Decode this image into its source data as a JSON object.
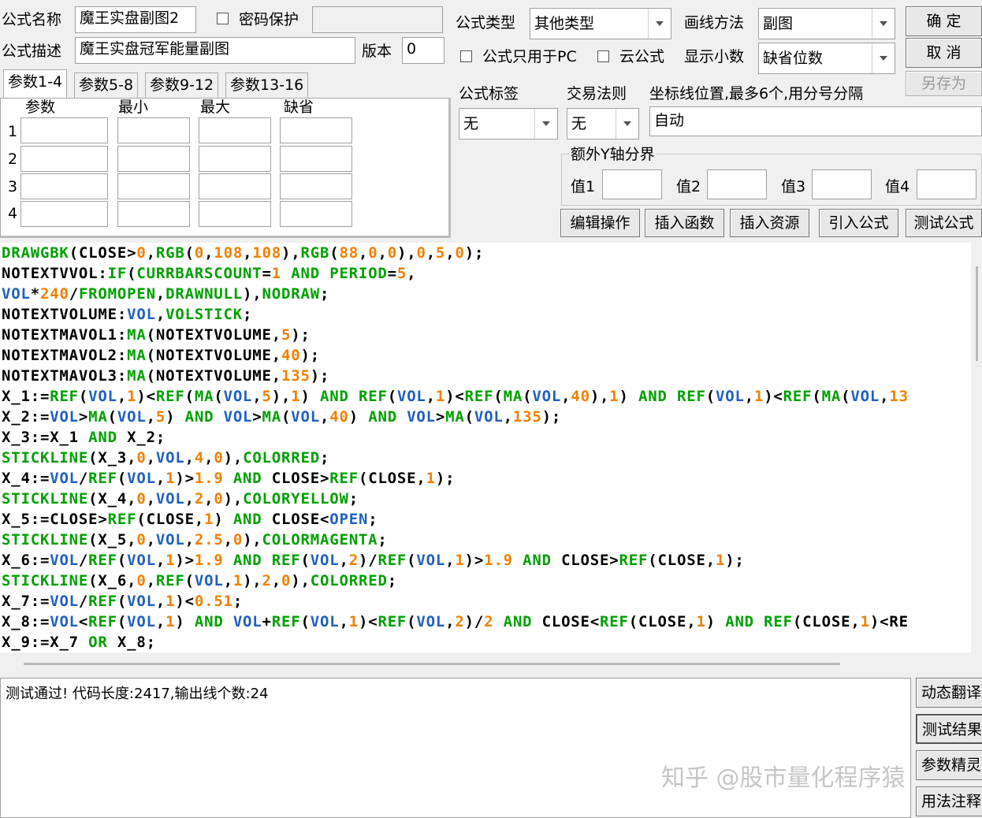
{
  "form": {
    "name_label": "公式名称",
    "name_value": "魔王实盘副图2",
    "password_label": "密码保护",
    "password_value": "",
    "desc_label": "公式描述",
    "desc_value": "魔王实盘冠军能量副图",
    "version_label": "版本",
    "version_value": "0",
    "type_label": "公式类型",
    "type_value": "其他类型",
    "draw_label": "画线方法",
    "draw_value": "副图",
    "pc_only_label": "公式只用于PC",
    "cloud_label": "云公式",
    "decimals_label": "显示小数",
    "decimals_value": "缺省位数"
  },
  "buttons": {
    "ok": "确 定",
    "cancel": "取 消",
    "save_as": "另存为",
    "edit": "编辑操作",
    "insert_func": "插入函数",
    "insert_res": "插入资源",
    "import": "引入公式",
    "test": "测试公式"
  },
  "tabs": [
    "参数1-4",
    "参数5-8",
    "参数9-12",
    "参数13-16"
  ],
  "params": {
    "headers": [
      "参数",
      "最小",
      "最大",
      "缺省"
    ],
    "rows": [
      "1",
      "2",
      "3",
      "4"
    ]
  },
  "tag": {
    "label": "公式标签",
    "value": "无"
  },
  "trade": {
    "label": "交易法则",
    "value": "无"
  },
  "coord": {
    "label": "坐标线位置,最多6个,用分号分隔",
    "value": "自动"
  },
  "yaxis": {
    "label": "额外Y轴分界",
    "v1": "值1",
    "v2": "值2",
    "v3": "值3",
    "v4": "值4"
  },
  "code_lines": [
    "DRAWGBK(CLOSE>0,RGB(0,108,108),RGB(88,0,0),0,5,0);",
    "NOTEXTVVOL:IF(CURRBARSCOUNT=1 AND PERIOD=5,",
    "VOL*240/FROMOPEN,DRAWNULL),NODRAW;",
    "NOTEXTVOLUME:VOL,VOLSTICK;",
    "NOTEXTMAVOL1:MA(NOTEXTVOLUME,5);",
    "NOTEXTMAVOL2:MA(NOTEXTVOLUME,40);",
    "NOTEXTMAVOL3:MA(NOTEXTVOLUME,135);",
    "X_1:=REF(VOL,1)<REF(MA(VOL,5),1) AND REF(VOL,1)<REF(MA(VOL,40),1) AND REF(VOL,1)<REF(MA(VOL,13",
    "X_2:=VOL>MA(VOL,5) AND VOL>MA(VOL,40) AND VOL>MA(VOL,135);",
    "X_3:=X_1 AND X_2;",
    "STICKLINE(X_3,0,VOL,4,0),COLORRED;",
    "X_4:=VOL/REF(VOL,1)>1.9 AND CLOSE>REF(CLOSE,1);",
    "STICKLINE(X_4,0,VOL,2,0),COLORYELLOW;",
    "X_5:=CLOSE>REF(CLOSE,1) AND CLOSE<OPEN;",
    "STICKLINE(X_5,0,VOL,2.5,0),COLORMAGENTA;",
    "X_6:=VOL/REF(VOL,1)>1.9 AND REF(VOL,2)/REF(VOL,1)>1.9 AND CLOSE>REF(CLOSE,1);",
    "STICKLINE(X_6,0,REF(VOL,1),2,0),COLORRED;",
    "X_7:=VOL/REF(VOL,1)<0.51;",
    "X_8:=VOL<REF(VOL,1) AND VOL+REF(VOL,1)<REF(VOL,2)/2 AND CLOSE<REF(CLOSE,1) AND REF(CLOSE,1)<RE",
    "X_9:=X_7 OR X_8;"
  ],
  "result_text": "测试通过! 代码长度:2417,输出线个数:24",
  "side_buttons": [
    "动态翻译",
    "测试结果",
    "参数精灵",
    "用法注释"
  ],
  "watermark": "知乎 @股市量化程序猿",
  "colors": {
    "func": "#00a000",
    "series": "#2060c0",
    "number": "#f08000",
    "plain": "#000000"
  }
}
